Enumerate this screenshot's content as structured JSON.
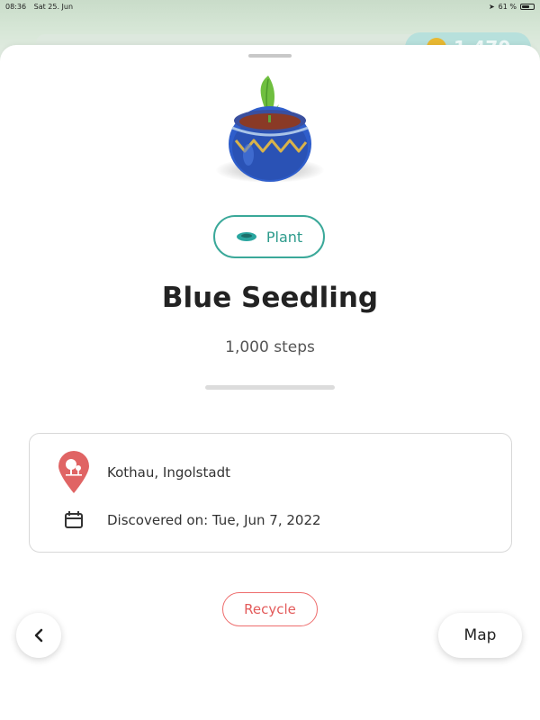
{
  "status_bar": {
    "time": "08:36",
    "date": "Sat 25. Jun",
    "battery": "61 %"
  },
  "background": {
    "coins": "1,470"
  },
  "item": {
    "category": "Plant",
    "name": "Blue Seedling",
    "steps": "1,000 steps",
    "location": "Kothau, Ingolstadt",
    "discovered": "Discovered on: Tue, Jun 7, 2022"
  },
  "actions": {
    "recycle_label": "Recycle",
    "map_label": "Map"
  },
  "icons": {
    "back": "chevron-left-icon",
    "location": "map-pin-tree-icon",
    "calendar": "calendar-icon",
    "category": "pot-icon",
    "coin": "coin-icon"
  },
  "colors": {
    "accent": "#3aa899",
    "danger": "#e35b5b",
    "location_pin": "#e06464",
    "pot": "#2f5ecb"
  }
}
